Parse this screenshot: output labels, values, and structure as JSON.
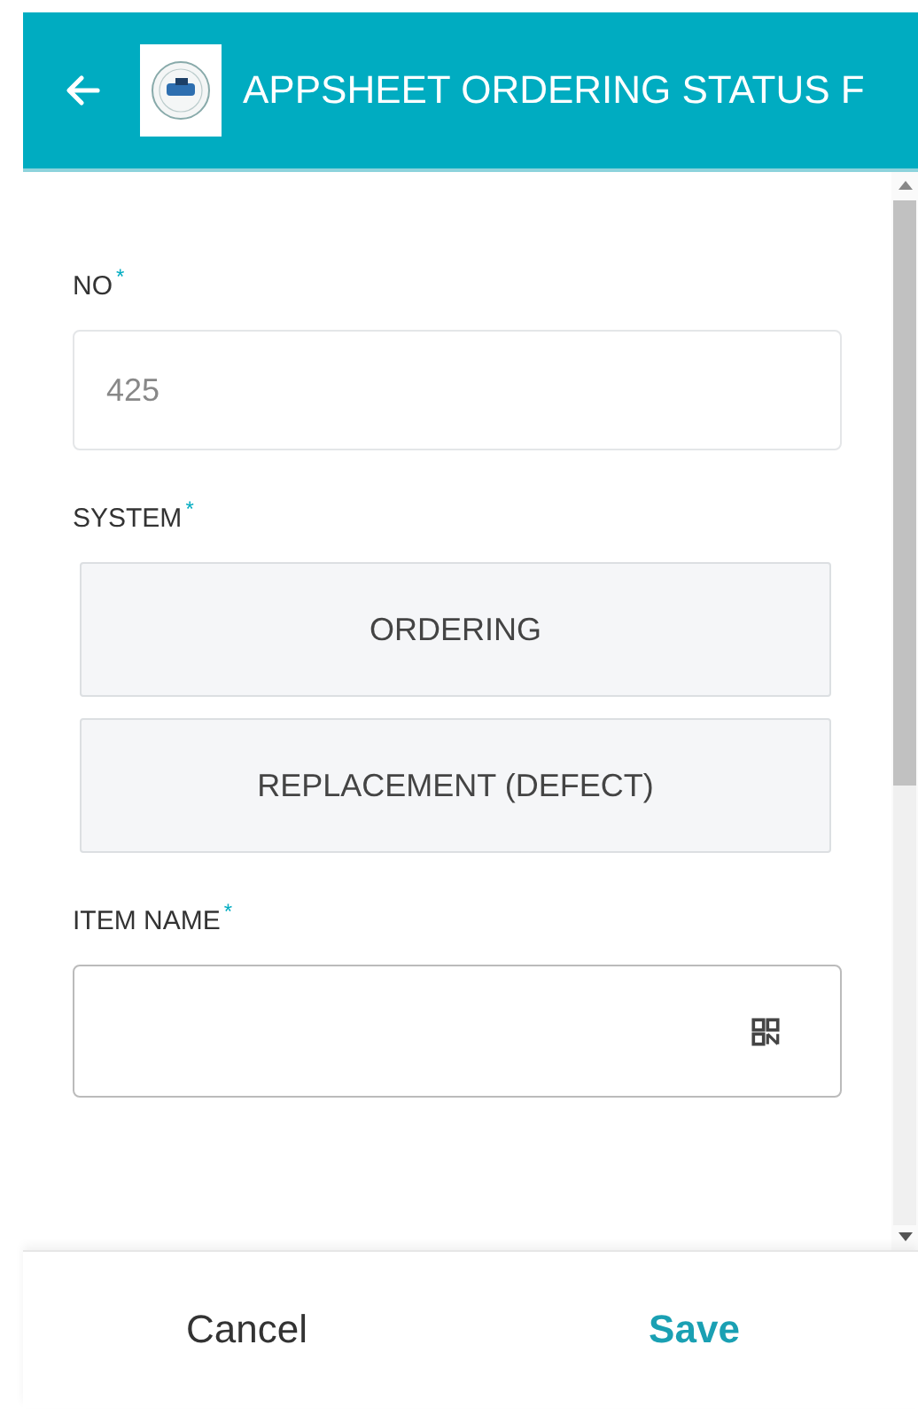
{
  "header": {
    "title": "APPSHEET ORDERING STATUS F"
  },
  "fields": [
    {
      "kind": "text",
      "label": "NO",
      "required_mark": "*",
      "value": "425"
    },
    {
      "kind": "choice",
      "label": "SYSTEM",
      "required_mark": "*",
      "options": [
        {
          "label": "ORDERING",
          "selected": false
        },
        {
          "label": "REPLACEMENT (DEFECT)",
          "selected": false
        }
      ]
    },
    {
      "kind": "scan",
      "label": "ITEM NAME",
      "required_mark": "*"
    }
  ],
  "footer": {
    "cancel": "Cancel",
    "save": "Save"
  }
}
